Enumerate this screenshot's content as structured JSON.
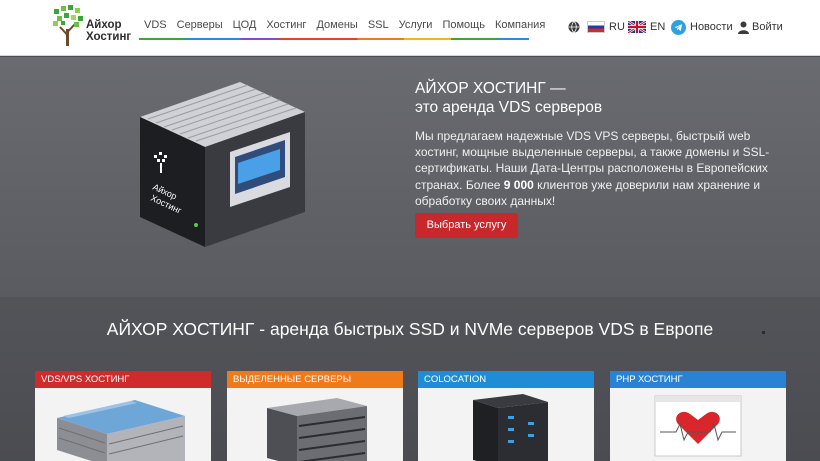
{
  "header": {
    "logo": {
      "line1": "Айхор",
      "line2": "Хостинг"
    },
    "nav": [
      "VDS",
      "Серверы",
      "ЦОД",
      "Хостинг",
      "Домены",
      "SSL",
      "Услуги",
      "Помощь",
      "Компания"
    ],
    "lang_ru": "RU",
    "lang_en": "EN",
    "news": "Новости",
    "login": "Войти",
    "icons": [
      "globe-icon",
      "flag-ru-icon",
      "flag-uk-icon",
      "telegram-icon",
      "user-icon"
    ]
  },
  "hero": {
    "title_line1": "АЙХОР ХОСТИНГ —",
    "title_line2": "это аренда VDS серверов",
    "desc_before": "Мы предлагаем надежные VDS VPS серверы, быстрый web хостинг, мощные выделенные серверы, а также домены и SSL-сертификаты. Наши Дата-Центры расположены в Европейских странах. Более ",
    "desc_bold": "9 000",
    "desc_after": " клиентов уже доверили нам хранение и обработку своих данных!",
    "button": "Выбрать услугу",
    "server_label_line1": "Айхор",
    "server_label_line2": "Хостинг"
  },
  "band": {
    "title": "АЙХОР ХОСТИНГ - аренда быстрых SSD и NVMe серверов VDS в Европе",
    "cards": [
      {
        "label": "VDS/VPS ХОСТИНГ"
      },
      {
        "label": "ВЫДЕЛЕННЫЕ СЕРВЕРЫ"
      },
      {
        "label": "COLOCATION"
      },
      {
        "label": "PHP ХОСТИНГ"
      }
    ]
  },
  "colors": {
    "button_red": "#c8282c",
    "card_vds": "#cf2b2b",
    "card_dedicated": "#ef7a1a",
    "card_colocation": "#1f8dd6",
    "card_php": "#2a83d2",
    "brand_green": "#3fa53a"
  }
}
